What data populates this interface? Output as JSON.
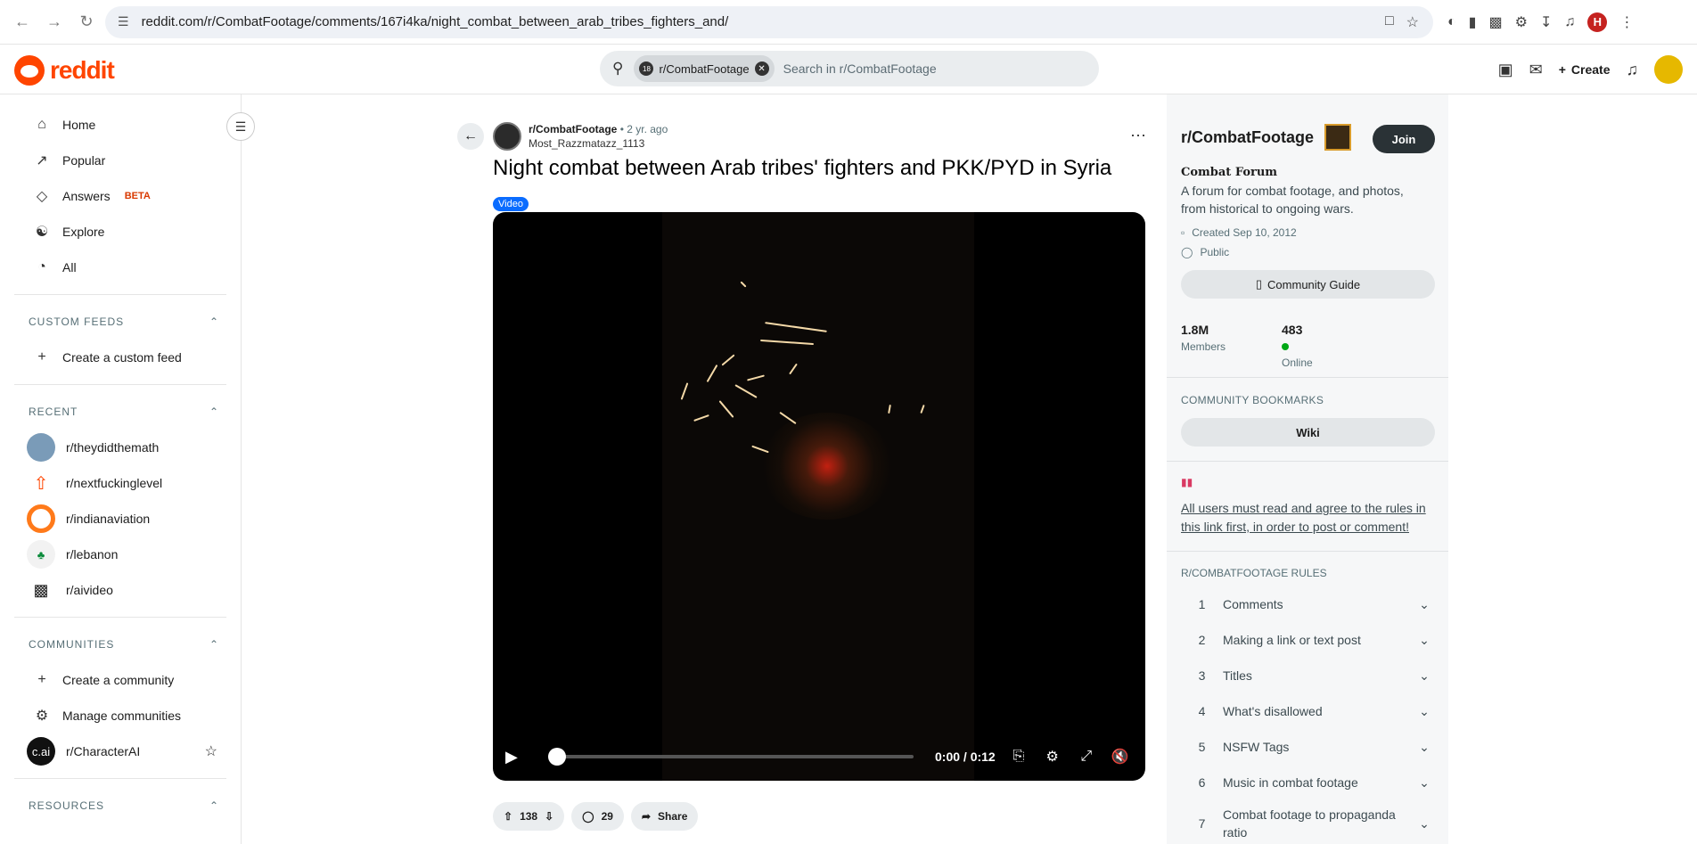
{
  "browser": {
    "url": "reddit.com/r/CombatFootage/comments/167i4ka/night_combat_between_arab_tribes_fighters_and/",
    "profile_initial": "H"
  },
  "header": {
    "logo_text": "reddit",
    "search_chip": "r/CombatFootage",
    "search_placeholder": "Search in r/CombatFootage",
    "create_label": "Create"
  },
  "left_sidebar": {
    "nav": [
      {
        "label": "Home",
        "icon": "home-icon"
      },
      {
        "label": "Popular",
        "icon": "popular-icon"
      },
      {
        "label": "Answers",
        "badge": "BETA",
        "icon": "answers-icon"
      },
      {
        "label": "Explore",
        "icon": "explore-icon"
      },
      {
        "label": "All",
        "icon": "all-icon"
      }
    ],
    "custom_feeds": {
      "heading": "CUSTOM FEEDS",
      "items": [
        "Create a custom feed"
      ]
    },
    "recent": {
      "heading": "RECENT",
      "items": [
        "r/theydidthemath",
        "r/nextfuckinglevel",
        "r/indianaviation",
        "r/lebanon",
        "r/aivideo"
      ]
    },
    "communities": {
      "heading": "COMMUNITIES",
      "items": [
        "Create a community",
        "Manage communities",
        "r/CharacterAI"
      ]
    },
    "resources": {
      "heading": "RESOURCES"
    }
  },
  "post": {
    "subreddit": "r/CombatFootage",
    "age": "• 2 yr. ago",
    "author": "Most_Razzmatazz_1113",
    "title": "Night combat between Arab tribes' fighters and PKK/PYD in Syria",
    "flair": "Video",
    "video": {
      "time": "0:00 / 0:12",
      "progress": 0.0
    },
    "votes": "138",
    "comments": "29",
    "share_label": "Share"
  },
  "right_sidebar": {
    "name": "r/CombatFootage",
    "join_label": "Join",
    "forum_name": "Combat Forum",
    "description": "A forum for combat footage, and photos, from historical to ongoing wars.",
    "created": "Created Sep 10, 2012",
    "visibility": "Public",
    "guide_label": "Community Guide",
    "members_value": "1.8M",
    "members_label": "Members",
    "online_value": "483",
    "online_label": "Online",
    "bookmarks_heading": "COMMUNITY BOOKMARKS",
    "wiki_label": "Wiki",
    "notice": "All users must read and agree to the rules in this link first, in order to post or comment!",
    "rules_heading": "R/COMBATFOOTAGE RULES",
    "rules": [
      {
        "num": "1",
        "text": "Comments"
      },
      {
        "num": "2",
        "text": "Making a link or text post"
      },
      {
        "num": "3",
        "text": "Titles"
      },
      {
        "num": "4",
        "text": "What's disallowed"
      },
      {
        "num": "5",
        "text": "NSFW Tags"
      },
      {
        "num": "6",
        "text": "Music in combat footage"
      },
      {
        "num": "7",
        "text": "Combat footage to propaganda ratio"
      }
    ]
  },
  "colors": {
    "brand": "#ff4500",
    "join_button": "#2a3236",
    "online_dot": "#01a816",
    "flair": "#0a6cff"
  }
}
